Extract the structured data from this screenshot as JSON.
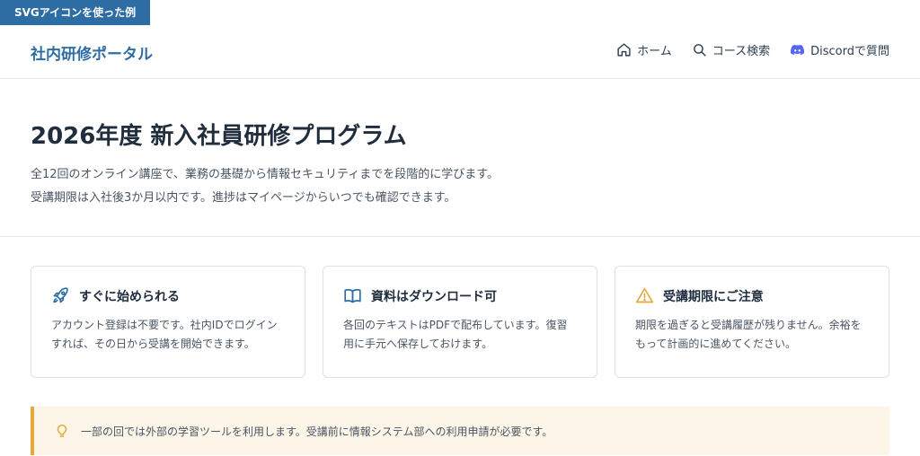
{
  "tag": "SVGアイコンを使った例",
  "header": {
    "logo": "社内研修ポータル",
    "nav": [
      {
        "icon": "home-icon",
        "label": "ホーム"
      },
      {
        "icon": "search-icon",
        "label": "コース検索"
      },
      {
        "icon": "discord-icon",
        "label": "Discordで質問"
      }
    ]
  },
  "hero": {
    "title": "2026年度 新入社員研修プログラム",
    "line1": "全12回のオンライン講座で、業務の基礎から情報セキュリティまでを段階的に学びます。",
    "line2": "受講期限は入社後3か月以内です。進捗はマイページからいつでも確認できます。"
  },
  "cards": [
    {
      "icon": "rocket-icon",
      "title": "すぐに始められる",
      "line1": "アカウント登録は不要です。社内IDでログイン",
      "line2": "すれば、その日から受講を開始できます。"
    },
    {
      "icon": "book-icon",
      "title": "資料はダウンロード可",
      "line1": "各回のテキストはPDFで配布しています。復習",
      "line2": "用に手元へ保存しておけます。"
    },
    {
      "icon": "warning-icon",
      "title": "受講期限にご注意",
      "line1": "期限を過ぎると受講履歴が残りません。余裕を",
      "line2": "もって計画的に進めてください。"
    }
  ],
  "notice": {
    "icon": "lightbulb-icon",
    "text": "一部の回では外部の学習ツールを利用します。受講前に情報システム部への利用申請が必要です。"
  },
  "colors": {
    "accent": "#2e6da4",
    "discord": "#5865f2",
    "warning": "#e5a93a",
    "notice_bg": "#fdf6e8"
  }
}
